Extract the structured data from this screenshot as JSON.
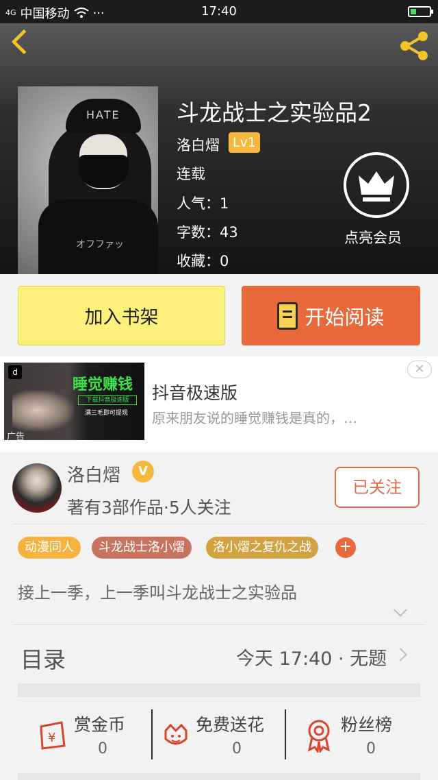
{
  "status_bar": {
    "signal": "4G",
    "carrier": "中国移动",
    "more": "···",
    "time": "17:40"
  },
  "book": {
    "title": "斗龙战士之实验品2",
    "author": "洛白熠",
    "level": "Lv1",
    "status": "连载",
    "popularity": "人气：1",
    "word_count": "字数：43",
    "favorites": "收藏：0",
    "cover_text": {
      "cap": "HATE",
      "shirt": "オフファッ"
    }
  },
  "vip": {
    "label": "点亮会员"
  },
  "actions": {
    "add_shelf": "加入书架",
    "start_reading": "开始阅读"
  },
  "ad": {
    "image_headline": "睡觉赚钱",
    "image_sub1": "下载抖音极速版",
    "image_sub2": "满三毛即可提现",
    "mark": "广告",
    "logo": "d",
    "title": "抖音极速版",
    "desc": "原来朋友说的睡觉赚钱是真的，…",
    "close": "✕"
  },
  "author_card": {
    "name": "洛白熠",
    "verified": "V",
    "stats": "著有3部作品·5人关注",
    "follow_label": "已关注"
  },
  "tags": [
    {
      "label": "动漫同人",
      "color": "#f5b23f"
    },
    {
      "label": "斗龙战士洛小熠",
      "color": "#c8735f"
    },
    {
      "label": "洛小熠之复仇之战",
      "color": "#d1a23f"
    }
  ],
  "tag_add": "+",
  "synopsis": "接上一季，上一季叫斗龙战士之实验品",
  "toc": {
    "label": "目录",
    "latest": "今天 17:40 · 无题"
  },
  "bottom_actions": [
    {
      "label": "赏金币",
      "value": "0"
    },
    {
      "label": "免费送花",
      "value": "0"
    },
    {
      "label": "粉丝榜",
      "value": "0"
    }
  ]
}
